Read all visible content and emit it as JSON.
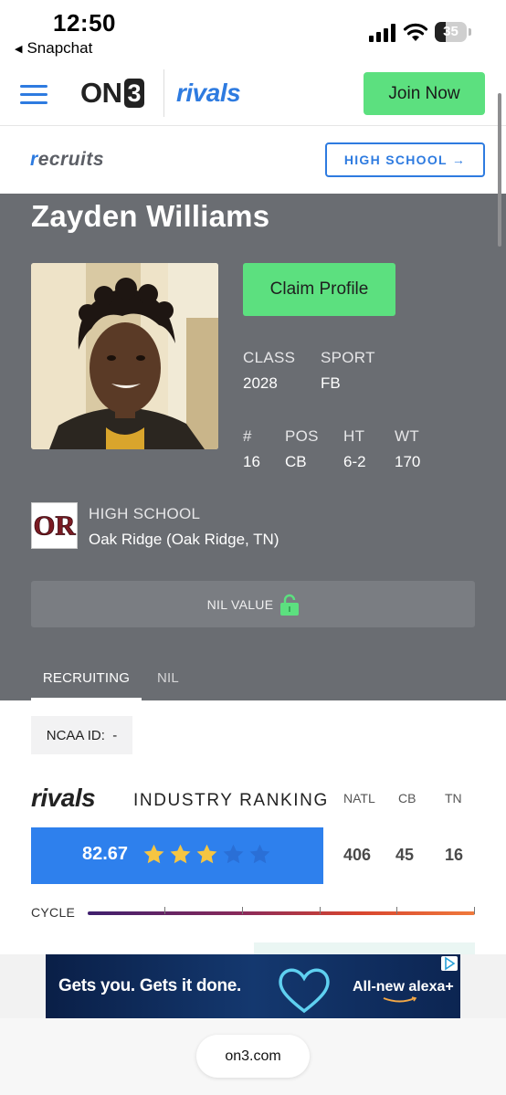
{
  "status_bar": {
    "time": "12:50",
    "back_app": "Snapchat",
    "battery": "35",
    "battery_level": 0.35
  },
  "header": {
    "brand_on3": "ON",
    "brand_on3_3": "3",
    "brand_rivals": "rivals",
    "join_label": "Join Now",
    "brand_green": "#5ce07f",
    "brand_blue": "#2e7be0"
  },
  "subheader": {
    "recruits_r": "r",
    "recruits_rest": "ecruits",
    "high_school_label": "HIGH SCHOOL →"
  },
  "profile": {
    "name": "Zayden Williams",
    "claim_label": "Claim Profile",
    "class_label": "CLASS",
    "class_value": "2028",
    "sport_label": "SPORT",
    "sport_value": "FB",
    "num_label": "#",
    "num_value": "16",
    "pos_label": "POS",
    "pos_value": "CB",
    "ht_label": "HT",
    "ht_value": "6-2",
    "wt_label": "WT",
    "wt_value": "170",
    "high_school_label": "HIGH SCHOOL",
    "high_school_value": "Oak Ridge (Oak Ridge, TN)",
    "high_school_logo_text": "OR",
    "nil_label": "NIL VALUE",
    "tabs": [
      {
        "label": "RECRUITING",
        "active": true
      },
      {
        "label": "NIL",
        "active": false
      }
    ]
  },
  "ranking": {
    "ncaa_label": "NCAA ID:",
    "ncaa_value": "-",
    "brand": "rivals",
    "title": "INDUSTRY RANKING",
    "col_natl": "NATL",
    "col_pos": "CB",
    "col_state": "TN",
    "score": "82.67",
    "stars": 3,
    "stars_max": 5,
    "natl": "406",
    "pos": "45",
    "state": "16",
    "cycle_label": "CYCLE"
  },
  "ad": {
    "headline": "Gets you. Gets it done.",
    "product": "All-new alexa+"
  },
  "bottom": {
    "url": "on3.com"
  }
}
